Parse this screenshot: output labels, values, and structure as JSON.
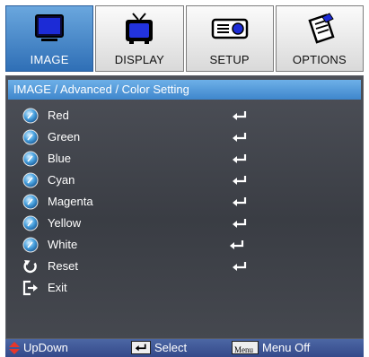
{
  "tabs": [
    {
      "label": "IMAGE",
      "icon": "monitor-icon",
      "active": true
    },
    {
      "label": "DISPLAY",
      "icon": "tv-icon",
      "active": false
    },
    {
      "label": "SETUP",
      "icon": "projector-icon",
      "active": false
    },
    {
      "label": "OPTIONS",
      "icon": "wrench-doc-icon",
      "active": false
    }
  ],
  "panel": {
    "breadcrumb": "IMAGE / Advanced / Color Setting",
    "items": [
      {
        "label": "Red",
        "icon": "knob-icon",
        "enter": true
      },
      {
        "label": "Green",
        "icon": "knob-icon",
        "enter": true
      },
      {
        "label": "Blue",
        "icon": "knob-icon",
        "enter": true
      },
      {
        "label": "Cyan",
        "icon": "knob-icon",
        "enter": true
      },
      {
        "label": "Magenta",
        "icon": "knob-icon",
        "enter": true
      },
      {
        "label": "Yellow",
        "icon": "knob-icon",
        "enter": true
      },
      {
        "label": "White",
        "icon": "knob-icon",
        "enter": true
      },
      {
        "label": "Reset",
        "icon": "reset-arrow-icon",
        "enter": true
      },
      {
        "label": "Exit",
        "icon": "exit-icon",
        "enter": false
      }
    ]
  },
  "status": {
    "updown_label": "UpDown",
    "select_label": "Select",
    "menu_key": "Menu",
    "menu_label": "Menu Off"
  },
  "colors": {
    "accent": "#3f86cc",
    "panel_bg": "#3f4249",
    "status_bg": "#3f5597",
    "updown_arrow": "#e8362b"
  }
}
